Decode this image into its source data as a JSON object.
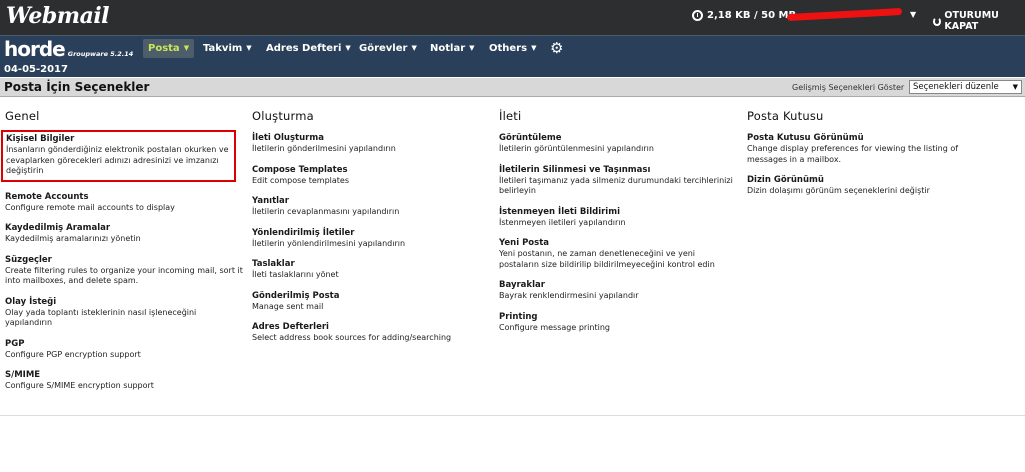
{
  "header": {
    "logo": "Webmail",
    "quota": "2,18 KB / 50 MB",
    "logout": "OTURUMU KAPAT"
  },
  "nav": {
    "brand": "horde",
    "brand_sub": "Groupware 5.2.14",
    "items": [
      {
        "label": "Posta"
      },
      {
        "label": "Takvim"
      },
      {
        "label": "Adres Defteri"
      },
      {
        "label": "Görevler"
      },
      {
        "label": "Notlar"
      },
      {
        "label": "Others"
      }
    ]
  },
  "date": "04-05-2017",
  "titlebar": {
    "title": "Posta İçin Seçenekler",
    "advanced_label": "Gelişmiş Seçenekleri Göster",
    "advanced_select": "Seçenekleri düzenle"
  },
  "columns": [
    {
      "title": "Genel",
      "items": [
        {
          "title": "Kişisel Bilgiler",
          "desc": "İnsanların gönderdiğiniz elektronik postaları okurken ve cevaplarken görecekleri adınızı adresinizi ve imzanızı değiştirin"
        },
        {
          "title": "Remote Accounts",
          "desc": "Configure remote mail accounts to display"
        },
        {
          "title": "Kaydedilmiş Aramalar",
          "desc": "Kaydedilmiş aramalarınızı yönetin"
        },
        {
          "title": "Süzgeçler",
          "desc": "Create filtering rules to organize your incoming mail, sort it into mailboxes, and delete spam."
        },
        {
          "title": "Olay İsteği",
          "desc": "Olay yada toplantı isteklerinin nasıl işleneceğini yapılandırın"
        },
        {
          "title": "PGP",
          "desc": "Configure PGP encryption support"
        },
        {
          "title": "S/MIME",
          "desc": "Configure S/MIME encryption support"
        }
      ]
    },
    {
      "title": "Oluşturma",
      "items": [
        {
          "title": "İleti Oluşturma",
          "desc": "İletilerin gönderilmesini yapılandırın"
        },
        {
          "title": "Compose Templates",
          "desc": "Edit compose templates"
        },
        {
          "title": "Yanıtlar",
          "desc": "İletilerin cevaplanmasını yapılandırın"
        },
        {
          "title": "Yönlendirilmiş İletiler",
          "desc": "İletilerin yönlendirilmesini yapılandırın"
        },
        {
          "title": "Taslaklar",
          "desc": "İleti taslaklarını yönet"
        },
        {
          "title": "Gönderilmiş Posta",
          "desc": "Manage sent mail"
        },
        {
          "title": "Adres Defterleri",
          "desc": "Select address book sources for adding/searching"
        }
      ]
    },
    {
      "title": "İleti",
      "items": [
        {
          "title": "Görüntüleme",
          "desc": "İletilerin görüntülenmesini yapılandırın"
        },
        {
          "title": "İletilerin Silinmesi ve Taşınması",
          "desc": "İletileri taşımanız yada silmeniz durumundaki tercihlerinizi belirleyin"
        },
        {
          "title": "İstenmeyen İleti Bildirimi",
          "desc": "İstenmeyen iletileri yapılandırın"
        },
        {
          "title": "Yeni Posta",
          "desc": "Yeni postanın, ne zaman denetleneceğini ve yeni postaların size bildirilip bildirilmeyeceğini kontrol edin"
        },
        {
          "title": "Bayraklar",
          "desc": "Bayrak renklendirmesini yapılandır"
        },
        {
          "title": "Printing",
          "desc": "Configure message printing"
        }
      ]
    },
    {
      "title": "Posta Kutusu",
      "items": [
        {
          "title": "Posta Kutusu Görünümü",
          "desc": "Change display preferences for viewing the listing of messages in a mailbox."
        },
        {
          "title": "Dizin Görünümü",
          "desc": "Dizin dolaşımı görünüm seçeneklerini değiştir"
        }
      ]
    }
  ]
}
